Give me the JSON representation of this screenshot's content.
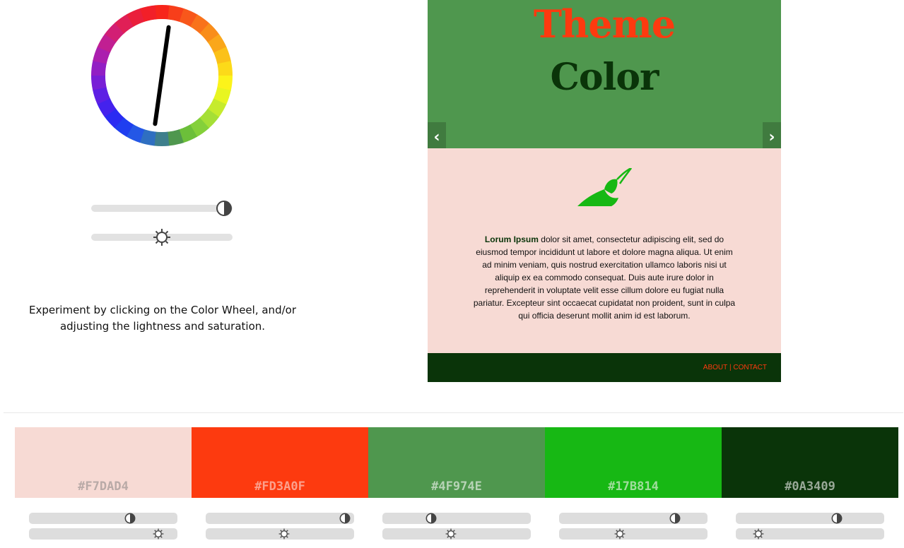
{
  "wheel": {
    "segments": [
      "#f7251a",
      "#f73e1a",
      "#f8571b",
      "#f9721b",
      "#f98d1a",
      "#faa71a",
      "#fbc119",
      "#fcda19",
      "#fcf31a",
      "#e8f521",
      "#c6eb2d",
      "#a5df36",
      "#84d03a",
      "#6cbf3a",
      "#4f974e",
      "#3e7f8c",
      "#2f6fc1",
      "#2457e6",
      "#1f3ef0",
      "#2a2bf2",
      "#4422ed",
      "#5e1fe4",
      "#781fd6",
      "#921fc4",
      "#ab1fae",
      "#c11f92",
      "#d21f74",
      "#e01f56",
      "#ea1f3b",
      "#f21f28"
    ],
    "needle_angle_deg": 188
  },
  "sliders": {
    "saturation": {
      "icon": "contrast-icon",
      "value": 0.94
    },
    "lightness": {
      "icon": "sun-icon",
      "value": 0.5
    }
  },
  "instructions": "Experiment by clicking on the Color Wheel, and/or adjusting the lightness and saturation.",
  "preview": {
    "title_line1": "Theme",
    "title_line2": "Color",
    "prev_arrow": "‹",
    "next_arrow": "›",
    "body_lead": "Lorum Ipsum",
    "body_text": " dolor sit amet, consectetur adipiscing elit, sed do eiusmod tempor incididunt ut labore et dolore magna aliqua. Ut enim ad minim veniam, quis nostrud exercitation ullamco laboris nisi ut aliquip ex ea commodo consequat. Duis aute irure dolor in reprehenderit in voluptate velit esse cillum dolore eu fugiat nulla pariatur. Excepteur sint occaecat cupidatat non proident, sunt in culpa qui officia deserunt mollit anim id est laborum.",
    "footer_about": "ABOUT",
    "footer_sep": " | ",
    "footer_contact": "CONTACT",
    "colors": {
      "hero_bg": "#4f974e",
      "title1": "#fd3a0f",
      "title2": "#0a3409",
      "content_bg": "#f7dad4",
      "leaf": "#17b814",
      "lead": "#0a3409",
      "footer_bg": "#0a3409",
      "footer_text": "#fd3a0f"
    }
  },
  "palette": [
    {
      "hex": "#F7DAD4",
      "bg": "#f7dad4",
      "text": "#b9aaa7",
      "saturation": 0.68,
      "lightness": 0.87
    },
    {
      "hex": "#FD3A0F",
      "bg": "#fd3a0f",
      "text": "#fca08c",
      "saturation": 0.94,
      "lightness": 0.53
    },
    {
      "hex": "#4F974E",
      "bg": "#4f974e",
      "text": "#b7d3b6",
      "saturation": 0.33,
      "lightness": 0.46
    },
    {
      "hex": "#17B814",
      "bg": "#17b814",
      "text": "#a0dd9c",
      "saturation": 0.78,
      "lightness": 0.41
    },
    {
      "hex": "#0A3409",
      "bg": "#0a3409",
      "text": "#98a897",
      "saturation": 0.68,
      "lightness": 0.15
    }
  ]
}
